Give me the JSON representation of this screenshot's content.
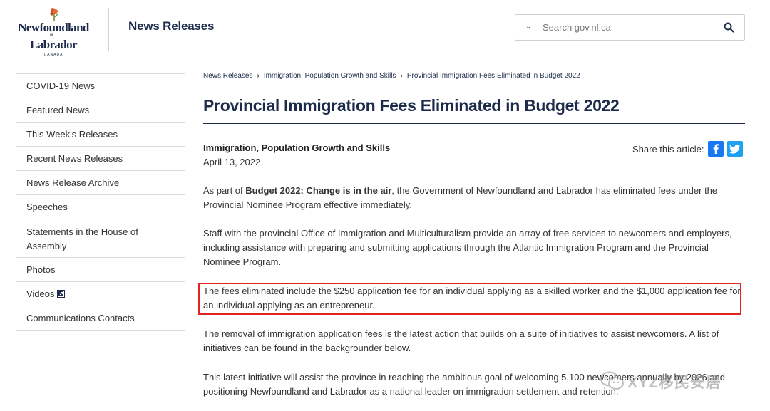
{
  "logo": {
    "line1": "Newfoundland",
    "amp": "&",
    "line2": "Labrador",
    "country": "CANADA"
  },
  "header": {
    "site_title": "News Releases"
  },
  "search": {
    "placeholder": "Search gov.nl.ca"
  },
  "sidebar": {
    "items": [
      {
        "label": "COVID-19 News"
      },
      {
        "label": "Featured News"
      },
      {
        "label": "This Week's Releases"
      },
      {
        "label": "Recent News Releases"
      },
      {
        "label": "News Release Archive"
      },
      {
        "label": "Speeches"
      },
      {
        "label": "Statements in the House of Assembly"
      },
      {
        "label": "Photos"
      },
      {
        "label": "Videos"
      },
      {
        "label": "Communications Contacts"
      }
    ]
  },
  "breadcrumb": {
    "items": [
      "News Releases",
      "Immigration, Population Growth and Skills",
      "Provincial Immigration Fees Eliminated in Budget 2022"
    ]
  },
  "article": {
    "title": "Provincial Immigration Fees Eliminated in Budget 2022",
    "department": "Immigration, Population Growth and Skills",
    "date": "April 13, 2022",
    "share_label": "Share this article:",
    "p1_before": "As part of ",
    "p1_bold": "Budget 2022: Change is in the air",
    "p1_after": ", the Government of Newfoundland and Labrador has eliminated fees under the Provincial Nominee Program effective immediately.",
    "p2": "Staff with the provincial Office of Immigration and Multiculturalism provide an array of free services to newcomers and employers, including assistance with preparing and submitting applications through the Atlantic Immigration Program and the Provincial Nominee Program.",
    "p3": "The fees eliminated include the $250 application fee for an individual applying as a skilled worker and the $1,000 application fee for an individual applying as an entrepreneur.",
    "p4": "The removal of immigration application fees is the latest action that builds on a suite of initiatives to assist newcomers. A list of initiatives can be found in the backgrounder below.",
    "p5": "This latest initiative will assist the province in reaching the ambitious goal of welcoming 5,100 newcomers annually by 2026 and positioning Newfoundland and Labrador as a national leader on immigration settlement and retention."
  },
  "watermark": {
    "text": "XYZ移民安居"
  },
  "colors": {
    "navy": "#1c2b4a",
    "highlight_border": "#e02424",
    "facebook": "#1877f2",
    "twitter": "#1da1f2"
  },
  "icons": {
    "search": "search-icon",
    "chevron": "chevron-down-icon",
    "facebook": "facebook-icon",
    "twitter": "twitter-icon",
    "external": "external-link-icon"
  }
}
